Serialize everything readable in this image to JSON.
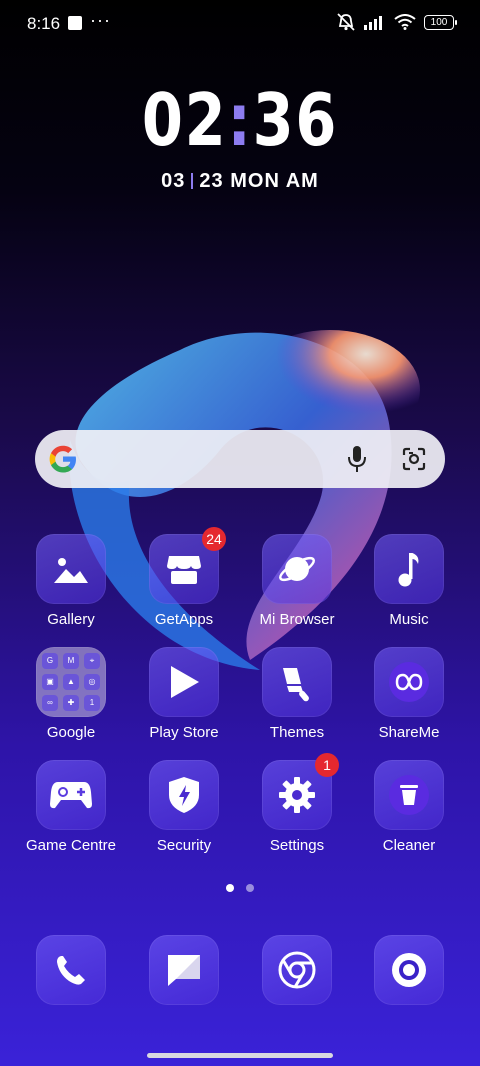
{
  "status": {
    "time": "8:16",
    "more": "···",
    "battery": "100"
  },
  "clock": {
    "hour": "02",
    "minute": "36",
    "date_left": "03",
    "date_right": "23 MON AM"
  },
  "search": {
    "placeholder": ""
  },
  "apps": [
    {
      "label": "Gallery"
    },
    {
      "label": "GetApps",
      "badge": "24"
    },
    {
      "label": "Mi Browser"
    },
    {
      "label": "Music"
    },
    {
      "label": "Google"
    },
    {
      "label": "Play Store"
    },
    {
      "label": "Themes"
    },
    {
      "label": "ShareMe"
    },
    {
      "label": "Game Centre"
    },
    {
      "label": "Security"
    },
    {
      "label": "Settings",
      "badge": "1"
    },
    {
      "label": "Cleaner"
    }
  ],
  "folder_icons": [
    "G",
    "M",
    "⌖",
    "▣",
    "▲",
    "◎",
    "∞",
    "✚",
    "1"
  ],
  "dock": [
    {
      "icon": "phone-icon"
    },
    {
      "icon": "messages-icon"
    },
    {
      "icon": "chrome-icon"
    },
    {
      "icon": "camera-icon"
    }
  ],
  "pager": {
    "pages": 2,
    "current": 1
  }
}
